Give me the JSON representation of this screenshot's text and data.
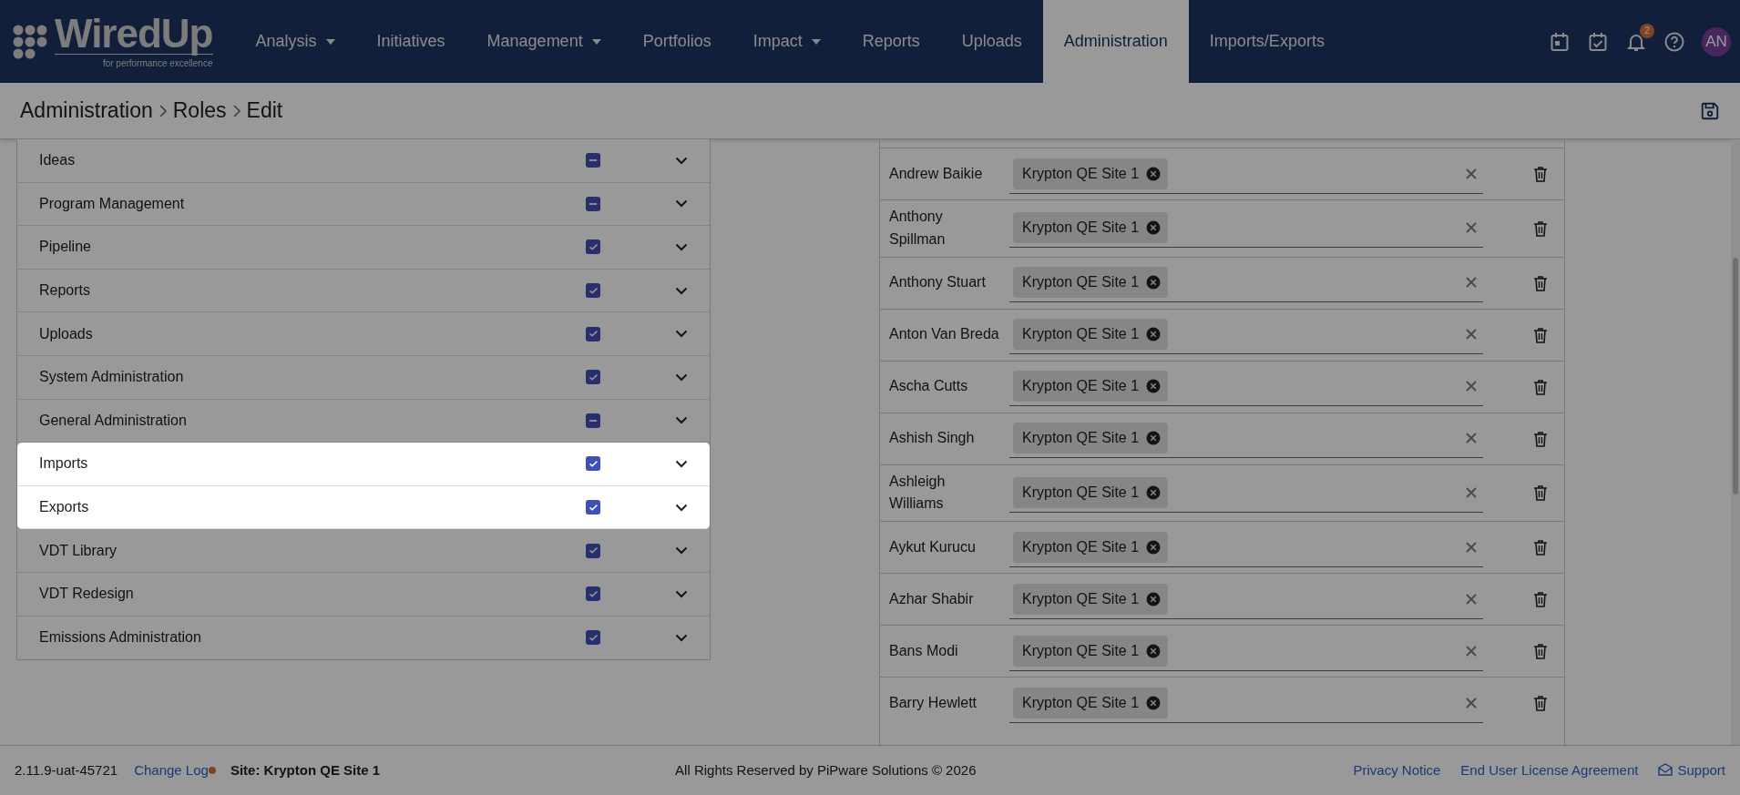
{
  "logo": {
    "name": "WiredUp",
    "tagline": "for performance excellence"
  },
  "nav": [
    {
      "label": "Analysis",
      "dropdown": true,
      "selected": false
    },
    {
      "label": "Initiatives",
      "dropdown": false,
      "selected": false
    },
    {
      "label": "Management",
      "dropdown": true,
      "selected": false
    },
    {
      "label": "Portfolios",
      "dropdown": false,
      "selected": false
    },
    {
      "label": "Impact",
      "dropdown": true,
      "selected": false
    },
    {
      "label": "Reports",
      "dropdown": false,
      "selected": false
    },
    {
      "label": "Uploads",
      "dropdown": false,
      "selected": false
    },
    {
      "label": "Administration",
      "dropdown": false,
      "selected": true
    },
    {
      "label": "Imports/Exports",
      "dropdown": false,
      "selected": false
    }
  ],
  "notifications": {
    "count": "2"
  },
  "user": {
    "initials": "AN"
  },
  "breadcrumb": [
    "Administration",
    "Roles",
    "Edit"
  ],
  "permissions": [
    {
      "name": "Ideas",
      "checked": false,
      "indeterminate": true,
      "highlighted": false
    },
    {
      "name": "Program Management",
      "checked": false,
      "indeterminate": true,
      "highlighted": false
    },
    {
      "name": "Pipeline",
      "checked": true,
      "indeterminate": false,
      "highlighted": false
    },
    {
      "name": "Reports",
      "checked": true,
      "indeterminate": false,
      "highlighted": false
    },
    {
      "name": "Uploads",
      "checked": true,
      "indeterminate": false,
      "highlighted": false
    },
    {
      "name": "System Administration",
      "checked": true,
      "indeterminate": false,
      "highlighted": false
    },
    {
      "name": "General Administration",
      "checked": false,
      "indeterminate": true,
      "highlighted": false
    },
    {
      "name": "Imports",
      "checked": true,
      "indeterminate": false,
      "highlighted": true
    },
    {
      "name": "Exports",
      "checked": true,
      "indeterminate": false,
      "highlighted": true
    },
    {
      "name": "VDT Library",
      "checked": true,
      "indeterminate": false,
      "highlighted": false
    },
    {
      "name": "VDT Redesign",
      "checked": true,
      "indeterminate": false,
      "highlighted": false
    },
    {
      "name": "Emissions Administration",
      "checked": true,
      "indeterminate": false,
      "highlighted": false
    }
  ],
  "users": [
    {
      "name": "Andrew Baikie",
      "sites": [
        "Krypton QE Site 1"
      ]
    },
    {
      "name": "Anthony Spillman",
      "sites": [
        "Krypton QE Site 1"
      ]
    },
    {
      "name": "Anthony Stuart",
      "sites": [
        "Krypton QE Site 1"
      ]
    },
    {
      "name": "Anton Van Breda",
      "sites": [
        "Krypton QE Site 1"
      ]
    },
    {
      "name": "Ascha Cutts",
      "sites": [
        "Krypton QE Site 1"
      ]
    },
    {
      "name": "Ashish Singh",
      "sites": [
        "Krypton QE Site 1"
      ]
    },
    {
      "name": "Ashleigh Williams",
      "sites": [
        "Krypton QE Site 1"
      ]
    },
    {
      "name": "Aykut Kurucu",
      "sites": [
        "Krypton QE Site 1"
      ]
    },
    {
      "name": "Azhar Shabir",
      "sites": [
        "Krypton QE Site 1"
      ]
    },
    {
      "name": "Bans Modi",
      "sites": [
        "Krypton QE Site 1"
      ]
    },
    {
      "name": "Barry Hewlett",
      "sites": [
        "Krypton QE Site 1"
      ]
    }
  ],
  "footer": {
    "version": "2.11.9-uat-45721",
    "change_log": {
      "label": "Change Log",
      "has_update": true
    },
    "site": "Site: Krypton QE Site 1",
    "copyright": "All Rights Reserved by PiPware Solutions © 2026",
    "links": [
      {
        "label": "Privacy Notice",
        "kind": "link"
      },
      {
        "label": "End User License Agreement",
        "kind": "link"
      },
      {
        "label": "Support",
        "kind": "support"
      }
    ]
  }
}
